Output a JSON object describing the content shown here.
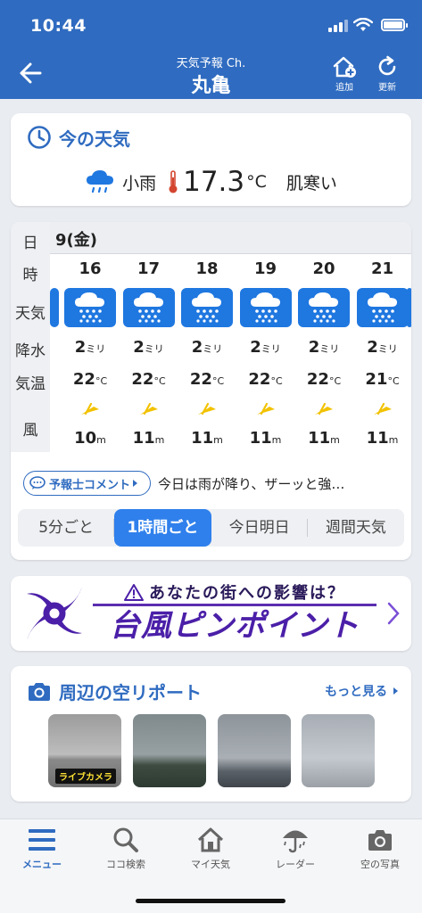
{
  "status": {
    "time": "10:44"
  },
  "header": {
    "subtitle": "天気予報 Ch.",
    "title": "丸亀",
    "add_label": "追加",
    "refresh_label": "更新"
  },
  "current": {
    "heading": "今の天気",
    "condition": "小雨",
    "temp": "17.3",
    "temp_unit": "°C",
    "feel": "肌寒い"
  },
  "forecast": {
    "row_labels": {
      "day": "日",
      "hour": "時",
      "weather": "天気",
      "rain": "降水",
      "temp": "気温",
      "wind": "風"
    },
    "date": "9(金)",
    "rain_unit": "ミリ",
    "temp_unit": "°C",
    "wind_unit": "m",
    "hours": [
      {
        "hour": "16",
        "rain": "2",
        "temp": "22",
        "wind": "10"
      },
      {
        "hour": "17",
        "rain": "2",
        "temp": "22",
        "wind": "11"
      },
      {
        "hour": "18",
        "rain": "2",
        "temp": "22",
        "wind": "11"
      },
      {
        "hour": "19",
        "rain": "2",
        "temp": "22",
        "wind": "11"
      },
      {
        "hour": "20",
        "rain": "2",
        "temp": "22",
        "wind": "11"
      },
      {
        "hour": "21",
        "rain": "2",
        "temp": "21",
        "wind": "11"
      }
    ],
    "comment_button": "予報士コメント",
    "comment_text": "今日は雨が降り、ザーッと強…",
    "segments": [
      "5分ごと",
      "1時間ごと",
      "今日明日",
      "週間天気"
    ],
    "selected_segment": "1時間ごと"
  },
  "banner": {
    "top": "あなたの街への影響は？",
    "main": "台風ピンポイント"
  },
  "sky_report": {
    "heading": "周辺の空リポート",
    "more": "もっと見る",
    "live_label": "ライブカメラ"
  },
  "tabs": [
    "メニュー",
    "ココ検索",
    "マイ天気",
    "レーダー",
    "空の写真"
  ],
  "colors": {
    "header": "#2f6bc0",
    "accent": "#2f80ec",
    "weather_box": "#1f77e0",
    "banner": "#4b1fa8"
  }
}
